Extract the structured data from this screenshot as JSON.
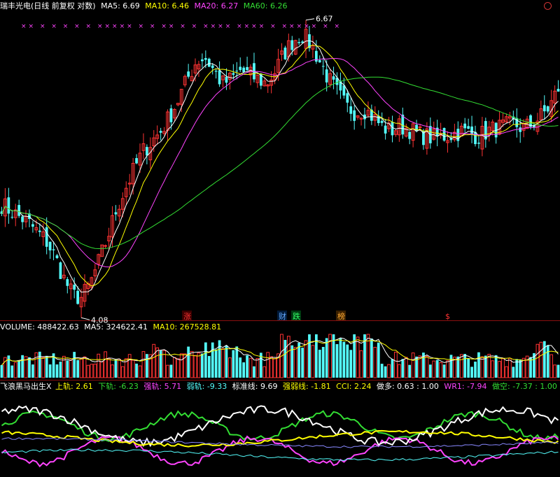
{
  "header": {
    "title": "瑞丰光电(日线 前复权 对数)",
    "ma5_label": "MA5: 6.69",
    "ma10_label": "MA10: 6.46",
    "ma20_label": "MA20: 6.27",
    "ma60_label": "MA60: 6.26",
    "circle_icon": "circle-icon"
  },
  "volume_header": {
    "volume_label": "VOLUME: 488422.63",
    "ma5_label": "MA5: 324622.41",
    "ma10_label": "MA10: 267528.81"
  },
  "indicator_header": {
    "name": "飞浪黑马出生X",
    "upper": "上轨: 2.61",
    "lower": "下轨: -6.23",
    "strong": "强轨: 5.71",
    "weak": "弱轨: -9.33",
    "std": "标准线: 9.69",
    "strength": "强弱线: -1.81",
    "cci": "CCI: 2.24",
    "long": "做多: 0.63 : 1.00",
    "wr": "WR1: -7.94",
    "short": "做空: -7.37 : 1.00"
  },
  "event_labels": [
    {
      "text": "涨",
      "color": "#ff3333",
      "bg": "#3a0000"
    },
    {
      "text": "财",
      "color": "#66aaff",
      "bg": "#001a3a"
    },
    {
      "text": "跌",
      "color": "#33ff66",
      "bg": "#003a10"
    },
    {
      "text": "榜",
      "color": "#ffaa33",
      "bg": "#3a2000"
    },
    {
      "text": "$",
      "color": "#ff3333",
      "bg": ""
    }
  ],
  "annotations": {
    "high_label": "6.67",
    "low_label": "4.08"
  },
  "colors": {
    "up": "#ff3333",
    "down": "#54fcfc",
    "ma5": "#ffffff",
    "ma10": "#ffff00",
    "ma20": "#ff44ff",
    "ma60": "#33dd33",
    "separator": "#8a1010"
  },
  "chart_data": {
    "type": "candlestick",
    "y_scale": "log",
    "ylim": [
      4.0,
      6.8
    ],
    "high": 6.67,
    "low": 4.08,
    "ohlc_close_trend": [
      4.86,
      4.8,
      4.75,
      4.7,
      4.62,
      4.55,
      4.42,
      4.25,
      4.12,
      4.1,
      4.2,
      4.38,
      4.58,
      4.82,
      5.0,
      5.18,
      5.35,
      5.45,
      5.55,
      5.7,
      5.88,
      6.1,
      6.3,
      6.35,
      6.2,
      6.05,
      6.1,
      6.2,
      6.15,
      6.1,
      6.05,
      6.2,
      6.4,
      6.55,
      6.62,
      6.5,
      6.3,
      6.1,
      5.95,
      5.8,
      5.75,
      5.78,
      5.7,
      5.6,
      5.55,
      5.6,
      5.58,
      5.52,
      5.5,
      5.48,
      5.5,
      5.52,
      5.55,
      5.53,
      5.5,
      5.55,
      5.58,
      5.6,
      5.62,
      5.58,
      5.62,
      5.7,
      5.8,
      6.0
    ],
    "volume": {
      "last": 488422.63,
      "ma5": 324622.41,
      "ma10": 267528.81
    }
  },
  "markers_top": "×× × × × × × ××××× × × ×× × × ×××× ×××× × ××××× × ×"
}
